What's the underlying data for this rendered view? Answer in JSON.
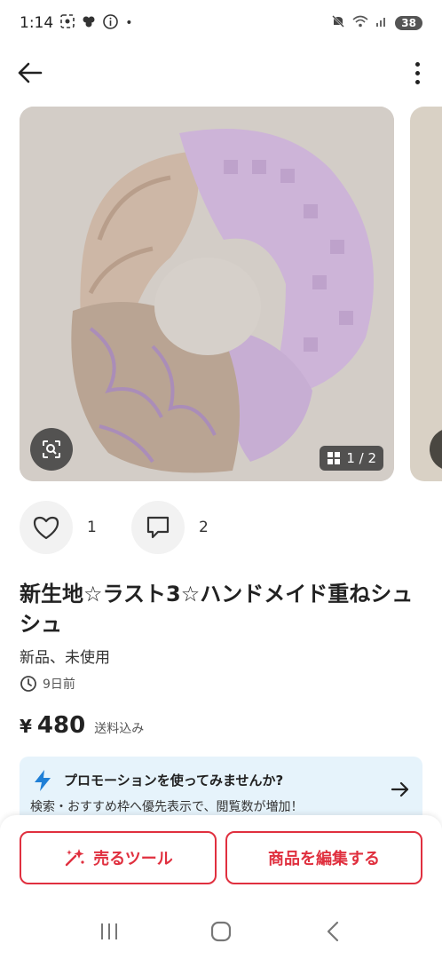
{
  "status_bar": {
    "time": "1:14",
    "dot": "•",
    "battery": "38"
  },
  "listing": {
    "image_counter": "1 / 2",
    "likes_count": "1",
    "comments_count": "2",
    "title": "新生地☆ラスト3☆ハンドメイド重ねシュシュ",
    "condition": "新品、未使用",
    "posted": "9日前",
    "price_currency": "¥",
    "price": "480",
    "shipping": "送料込み"
  },
  "promo": {
    "title": "プロモーションを使ってみませんか?",
    "description": "検索・おすすめ枠へ優先表示で、閲覧数が増加！"
  },
  "bottom_actions": {
    "sell_tool_label": "売るツール",
    "edit_label": "商品を編集する"
  },
  "colors": {
    "accent_red": "#e0303f",
    "promo_bg": "#e6f3fb",
    "promo_bolt": "#1f7fd6"
  },
  "icons": [
    "back-arrow-icon",
    "more-vert-icon",
    "lens-search-icon",
    "grid-icon",
    "heart-icon",
    "comment-icon",
    "clock-icon",
    "bolt-icon",
    "arrow-right-icon",
    "sparkle-icon",
    "recents-icon",
    "home-icon",
    "back-icon"
  ]
}
